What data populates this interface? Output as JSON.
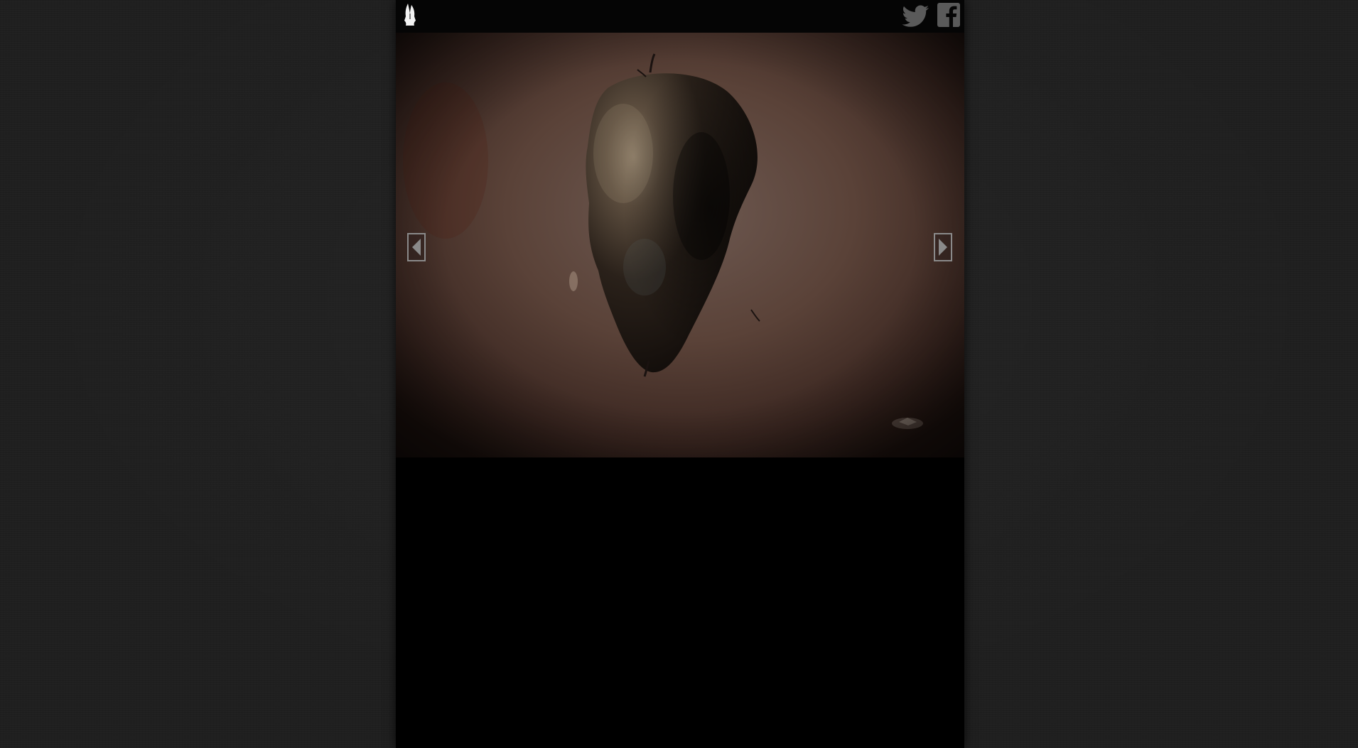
{
  "header": {
    "logo_icon": "pale-bird-icon",
    "social": [
      {
        "name": "Twitter",
        "icon": "twitter-icon"
      },
      {
        "name": "Facebook",
        "icon": "facebook-icon"
      }
    ]
  },
  "gallery": {
    "image_subject": "dark-stone-head-sculpture",
    "prev_icon": "left-arrow-icon",
    "next_icon": "right-arrow-icon"
  },
  "colors": {
    "page_background": "#1f1f1f",
    "column_background": "#000000",
    "topbar_background": "#050505",
    "icon_gray": "#5a5a5a",
    "logo_white": "#f2f2f2",
    "photo_wall": "#5a4238"
  }
}
